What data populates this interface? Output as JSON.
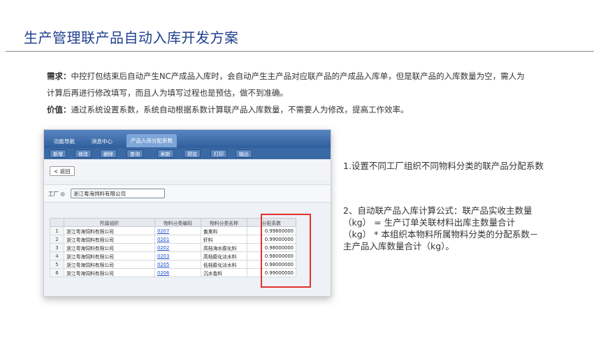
{
  "slide": {
    "title": "生产管理联产品自动入库开发方案"
  },
  "description": {
    "need_label": "需求：",
    "need_text": "中控打包结束后自动产生NC产成品入库时，会自动产生主产品对应联产品的产成品入库单，但是联产品的入库数量为空，需人为计算后再进行修改填写，而且人为填写过程也是预估，做不到准确。",
    "value_label": "价值：",
    "value_text": "通过系统设置系数，系统自动根据系数计算联产品入库数量，不需要人为修改，提高工作效率。"
  },
  "app": {
    "tabs": [
      "功能导航",
      "消息中心",
      "产品入库分配系数"
    ],
    "toolbar": [
      "新增",
      "修改",
      "删除",
      "查询",
      "刷新",
      "预览",
      "打印",
      "输出"
    ],
    "back_label": "< 返回",
    "org_label": "工厂 ◎",
    "org_value": "浙江粤海饲料有限公司",
    "columns": [
      "",
      "所属组织",
      "物料分类编码",
      "物料分类名称",
      "分配系数"
    ],
    "rows": [
      {
        "no": "1",
        "org": "浙江粤海饲料有限公司",
        "code": "0207",
        "name": "畜禽料",
        "coef": "0.99800000"
      },
      {
        "no": "2",
        "org": "浙江粤海饲料有限公司",
        "code": "0201",
        "name": "虾料",
        "coef": "0.99000000"
      },
      {
        "no": "3",
        "org": "浙江粤海饲料有限公司",
        "code": "0202",
        "name": "高档海水膨化料",
        "coef": "0.98000000"
      },
      {
        "no": "4",
        "org": "浙江粤海饲料有限公司",
        "code": "0203",
        "name": "高档膨化淡水料",
        "coef": "0.98000000"
      },
      {
        "no": "5",
        "org": "浙江粤海饲料有限公司",
        "code": "0205",
        "name": "低档膨化淡水料",
        "coef": "0.98000000"
      },
      {
        "no": "6",
        "org": "浙江粤海饲料有限公司",
        "code": "0206",
        "name": "沉水鱼料",
        "coef": "0.99000000"
      }
    ]
  },
  "notes": {
    "note1": "1.设置不同工厂组织不同物料分类的联产品分配系数",
    "note2": "2、自动联产品入库计算公式：联产品实收主数量（kg） = 生产订单关联材料出库主数量合计（kg） * 本组织本物料所属物料分类的分配系数－主产品入库数量合计（kg）。"
  },
  "colors": {
    "title": "#1f3f8f",
    "tabbar": "#3c6aa8",
    "highlight": "#e0322f",
    "link": "#1a4fd0"
  }
}
